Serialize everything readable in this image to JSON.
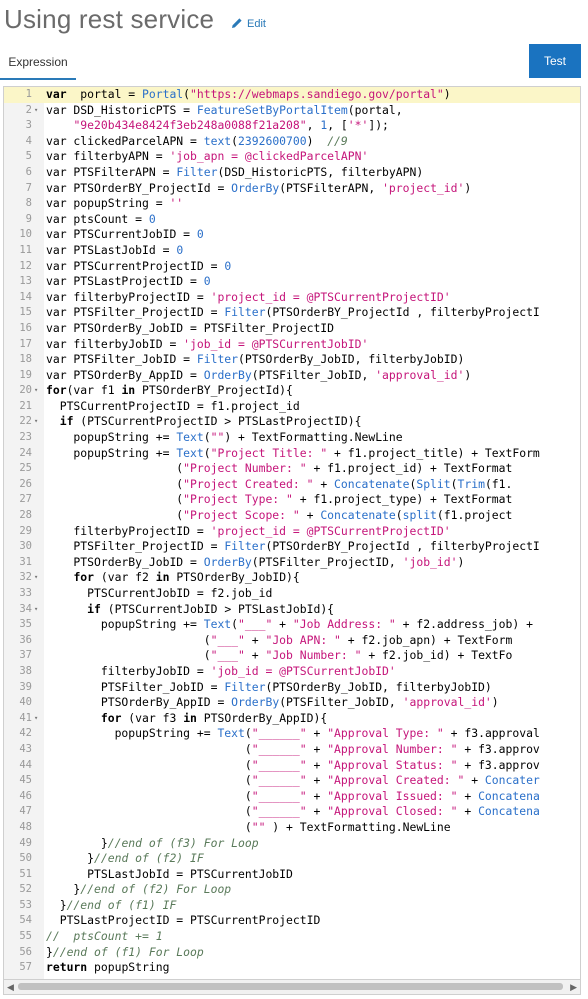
{
  "header": {
    "title": "Using rest service",
    "edit_label": "Edit"
  },
  "tabs": [
    {
      "label": "Expression"
    }
  ],
  "toolbar": {
    "test_label": "Test"
  },
  "colors": {
    "accent": "#1a73c0",
    "string": "#c5157a",
    "function": "#2a6fc9",
    "comment": "#5a7a5a"
  },
  "editor": {
    "lines": [
      {
        "n": "1",
        "fold": false,
        "t": [
          [
            "k",
            "var"
          ],
          [
            "",
            "  portal = "
          ],
          [
            "f",
            "Portal"
          ],
          [
            "",
            "("
          ],
          [
            "s",
            "\"https://webmaps.sandiego.gov/portal\""
          ],
          [
            "",
            ")"
          ]
        ]
      },
      {
        "n": "2",
        "fold": true,
        "t": [
          [
            "",
            "var DSD_HistoricPTS = "
          ],
          [
            "f",
            "FeatureSetByPortalItem"
          ],
          [
            "",
            "(portal,"
          ]
        ]
      },
      {
        "n": "3",
        "fold": false,
        "t": [
          [
            "",
            "    "
          ],
          [
            "s",
            "\"9e20b434e8424f3eb248a0088f21a208\""
          ],
          [
            "",
            ", "
          ],
          [
            "n",
            "1"
          ],
          [
            "",
            ", ["
          ],
          [
            "s",
            "'*'"
          ],
          [
            "",
            "]);"
          ]
        ]
      },
      {
        "n": "4",
        "fold": false,
        "t": [
          [
            "",
            "var clickedParcelAPN = "
          ],
          [
            "f",
            "text"
          ],
          [
            "",
            "("
          ],
          [
            "n",
            "2392600700"
          ],
          [
            "",
            ")  "
          ],
          [
            "c",
            "//9"
          ]
        ]
      },
      {
        "n": "5",
        "fold": false,
        "t": [
          [
            "",
            "var filterbyAPN = "
          ],
          [
            "s",
            "'job_apn = @clickedParcelAPN'"
          ]
        ]
      },
      {
        "n": "6",
        "fold": false,
        "t": [
          [
            "",
            "var PTSFilterAPN = "
          ],
          [
            "f",
            "Filter"
          ],
          [
            "",
            "(DSD_HistoricPTS, filterbyAPN)"
          ]
        ]
      },
      {
        "n": "7",
        "fold": false,
        "t": [
          [
            "",
            "var PTSOrderBY_ProjectId = "
          ],
          [
            "f",
            "OrderBy"
          ],
          [
            "",
            "(PTSFilterAPN, "
          ],
          [
            "s",
            "'project_id'"
          ],
          [
            "",
            ")"
          ]
        ]
      },
      {
        "n": "8",
        "fold": false,
        "t": [
          [
            "",
            "var popupString = "
          ],
          [
            "s",
            "''"
          ]
        ]
      },
      {
        "n": "9",
        "fold": false,
        "t": [
          [
            "",
            "var ptsCount = "
          ],
          [
            "n",
            "0"
          ]
        ]
      },
      {
        "n": "10",
        "fold": false,
        "t": [
          [
            "",
            "var PTSCurrentJobID = "
          ],
          [
            "n",
            "0"
          ]
        ]
      },
      {
        "n": "11",
        "fold": false,
        "t": [
          [
            "",
            "var PTSLastJobId = "
          ],
          [
            "n",
            "0"
          ]
        ]
      },
      {
        "n": "12",
        "fold": false,
        "t": [
          [
            "",
            "var PTSCurrentProjectID = "
          ],
          [
            "n",
            "0"
          ]
        ]
      },
      {
        "n": "13",
        "fold": false,
        "t": [
          [
            "",
            "var PTSLastProjectID = "
          ],
          [
            "n",
            "0"
          ]
        ]
      },
      {
        "n": "14",
        "fold": false,
        "t": [
          [
            "",
            "var filterbyProjectID = "
          ],
          [
            "s",
            "'project_id = @PTSCurrentProjectID'"
          ]
        ]
      },
      {
        "n": "15",
        "fold": false,
        "t": [
          [
            "",
            "var PTSFilter_ProjectID = "
          ],
          [
            "f",
            "Filter"
          ],
          [
            "",
            "(PTSOrderBY_ProjectId , filterbyProjectI"
          ]
        ]
      },
      {
        "n": "16",
        "fold": false,
        "t": [
          [
            "",
            "var PTSOrderBy_JobID = PTSFilter_ProjectID"
          ]
        ]
      },
      {
        "n": "17",
        "fold": false,
        "t": [
          [
            "",
            "var filterbyJobID = "
          ],
          [
            "s",
            "'job_id = @PTSCurrentJobID'"
          ]
        ]
      },
      {
        "n": "18",
        "fold": false,
        "t": [
          [
            "",
            "var PTSFilter_JobID = "
          ],
          [
            "f",
            "Filter"
          ],
          [
            "",
            "(PTSOrderBy_JobID, filterbyJobID)"
          ]
        ]
      },
      {
        "n": "19",
        "fold": false,
        "t": [
          [
            "",
            "var PTSOrderBy_AppID = "
          ],
          [
            "f",
            "OrderBy"
          ],
          [
            "",
            "(PTSFilter_JobID, "
          ],
          [
            "s",
            "'approval_id'"
          ],
          [
            "",
            ")"
          ]
        ]
      },
      {
        "n": "20",
        "fold": true,
        "t": [
          [
            "k",
            "for"
          ],
          [
            "",
            ""
          ],
          [
            "",
            "(var f1 "
          ],
          [
            "k",
            "in"
          ],
          [
            "",
            " PTSOrderBY_ProjectId){"
          ]
        ]
      },
      {
        "n": "21",
        "fold": false,
        "t": [
          [
            "",
            "  PTSCurrentProjectID = f1.project_id"
          ]
        ]
      },
      {
        "n": "22",
        "fold": true,
        "t": [
          [
            "",
            "  "
          ],
          [
            "k",
            "if"
          ],
          [
            "",
            " (PTSCurrentProjectID > PTSLastProjectID){"
          ]
        ]
      },
      {
        "n": "23",
        "fold": false,
        "t": [
          [
            "",
            "    popupString += "
          ],
          [
            "f",
            "Text"
          ],
          [
            "",
            "("
          ],
          [
            "s",
            "\"\""
          ],
          [
            "",
            ") + TextFormatting.NewLine"
          ]
        ]
      },
      {
        "n": "24",
        "fold": false,
        "t": [
          [
            "",
            "    popupString += "
          ],
          [
            "f",
            "Text"
          ],
          [
            "",
            "("
          ],
          [
            "s",
            "\"Project Title: \""
          ],
          [
            "",
            " + f1.project_title) + TextForm"
          ]
        ]
      },
      {
        "n": "25",
        "fold": false,
        "t": [
          [
            "",
            "                   ("
          ],
          [
            "s",
            "\"Project Number: \""
          ],
          [
            "",
            " + f1.project_id) + TextFormat"
          ]
        ]
      },
      {
        "n": "26",
        "fold": false,
        "t": [
          [
            "",
            "                   ("
          ],
          [
            "s",
            "\"Project Created: \""
          ],
          [
            "",
            " + "
          ],
          [
            "f",
            "Concatenate"
          ],
          [
            "",
            "("
          ],
          [
            "f",
            "Split"
          ],
          [
            "",
            "("
          ],
          [
            "f",
            "Trim"
          ],
          [
            "",
            "(f1."
          ]
        ]
      },
      {
        "n": "27",
        "fold": false,
        "t": [
          [
            "",
            "                   ("
          ],
          [
            "s",
            "\"Project Type: \""
          ],
          [
            "",
            " + f1.project_type) + TextFormat"
          ]
        ]
      },
      {
        "n": "28",
        "fold": false,
        "t": [
          [
            "",
            "                   ("
          ],
          [
            "s",
            "\"Project Scope: \""
          ],
          [
            "",
            " + "
          ],
          [
            "f",
            "Concatenate"
          ],
          [
            "",
            "("
          ],
          [
            "f",
            "split"
          ],
          [
            "",
            "(f1.project"
          ]
        ]
      },
      {
        "n": "29",
        "fold": false,
        "t": [
          [
            "",
            "    filterbyProjectID = "
          ],
          [
            "s",
            "'project_id = @PTSCurrentProjectID'"
          ]
        ]
      },
      {
        "n": "30",
        "fold": false,
        "t": [
          [
            "",
            "    PTSFilter_ProjectID = "
          ],
          [
            "f",
            "Filter"
          ],
          [
            "",
            "(PTSOrderBY_ProjectId , filterbyProjectI"
          ]
        ]
      },
      {
        "n": "31",
        "fold": false,
        "t": [
          [
            "",
            "    PTSOrderBy_JobID = "
          ],
          [
            "f",
            "OrderBy"
          ],
          [
            "",
            "(PTSFilter_ProjectID, "
          ],
          [
            "s",
            "'job_id'"
          ],
          [
            "",
            ")"
          ]
        ]
      },
      {
        "n": "32",
        "fold": true,
        "t": [
          [
            "",
            "    "
          ],
          [
            "k",
            "for"
          ],
          [
            "",
            " (var f2 "
          ],
          [
            "k",
            "in"
          ],
          [
            "",
            " PTSOrderBy_JobID){"
          ]
        ]
      },
      {
        "n": "33",
        "fold": false,
        "t": [
          [
            "",
            "      PTSCurrentJobID = f2.job_id"
          ]
        ]
      },
      {
        "n": "34",
        "fold": true,
        "t": [
          [
            "",
            "      "
          ],
          [
            "k",
            "if"
          ],
          [
            "",
            " (PTSCurrentJobID > PTSLastJobId){"
          ]
        ]
      },
      {
        "n": "35",
        "fold": false,
        "t": [
          [
            "",
            "        popupString += "
          ],
          [
            "f",
            "Text"
          ],
          [
            "",
            "("
          ],
          [
            "s",
            "\"___\""
          ],
          [
            "",
            " + "
          ],
          [
            "s",
            "\"Job Address: \""
          ],
          [
            "",
            " + f2.address_job) +"
          ]
        ]
      },
      {
        "n": "36",
        "fold": false,
        "t": [
          [
            "",
            "                       ("
          ],
          [
            "s",
            "\"___\""
          ],
          [
            "",
            " + "
          ],
          [
            "s",
            "\"Job APN: \""
          ],
          [
            "",
            " + f2.job_apn) + TextForm"
          ]
        ]
      },
      {
        "n": "37",
        "fold": false,
        "t": [
          [
            "",
            "                       ("
          ],
          [
            "s",
            "\"___\""
          ],
          [
            "",
            " + "
          ],
          [
            "s",
            "\"Job Number: \""
          ],
          [
            "",
            " + f2.job_id) + TextFo"
          ]
        ]
      },
      {
        "n": "38",
        "fold": false,
        "t": [
          [
            "",
            "        filterbyJobID = "
          ],
          [
            "s",
            "'job_id = @PTSCurrentJobID'"
          ]
        ]
      },
      {
        "n": "39",
        "fold": false,
        "t": [
          [
            "",
            "        PTSFilter_JobID = "
          ],
          [
            "f",
            "Filter"
          ],
          [
            "",
            "(PTSOrderBy_JobID, filterbyJobID)"
          ]
        ]
      },
      {
        "n": "40",
        "fold": false,
        "t": [
          [
            "",
            "        PTSOrderBy_AppID = "
          ],
          [
            "f",
            "OrderBy"
          ],
          [
            "",
            "(PTSFilter_JobID, "
          ],
          [
            "s",
            "'approval_id'"
          ],
          [
            "",
            ")"
          ]
        ]
      },
      {
        "n": "41",
        "fold": true,
        "t": [
          [
            "",
            "        "
          ],
          [
            "k",
            "for"
          ],
          [
            "",
            " (var f3 "
          ],
          [
            "k",
            "in"
          ],
          [
            "",
            " PTSOrderBy_AppID){"
          ]
        ]
      },
      {
        "n": "42",
        "fold": false,
        "t": [
          [
            "",
            "          popupString += "
          ],
          [
            "f",
            "Text"
          ],
          [
            "",
            "("
          ],
          [
            "s",
            "\"______\""
          ],
          [
            "",
            " + "
          ],
          [
            "s",
            "\"Approval Type: \""
          ],
          [
            "",
            " + f3.approval"
          ]
        ]
      },
      {
        "n": "43",
        "fold": false,
        "t": [
          [
            "",
            "                             ("
          ],
          [
            "s",
            "\"______\""
          ],
          [
            "",
            " + "
          ],
          [
            "s",
            "\"Approval Number: \""
          ],
          [
            "",
            " + f3.approv"
          ]
        ]
      },
      {
        "n": "44",
        "fold": false,
        "t": [
          [
            "",
            "                             ("
          ],
          [
            "s",
            "\"______\""
          ],
          [
            "",
            " + "
          ],
          [
            "s",
            "\"Approval Status: \""
          ],
          [
            "",
            " + f3.approv"
          ]
        ]
      },
      {
        "n": "45",
        "fold": false,
        "t": [
          [
            "",
            "                             ("
          ],
          [
            "s",
            "\"______\""
          ],
          [
            "",
            " + "
          ],
          [
            "s",
            "\"Approval Created: \""
          ],
          [
            "",
            " + "
          ],
          [
            "f",
            "Concater"
          ]
        ]
      },
      {
        "n": "46",
        "fold": false,
        "t": [
          [
            "",
            "                             ("
          ],
          [
            "s",
            "\"______\""
          ],
          [
            "",
            " + "
          ],
          [
            "s",
            "\"Approval Issued: \""
          ],
          [
            "",
            " + "
          ],
          [
            "f",
            "Concatena"
          ]
        ]
      },
      {
        "n": "47",
        "fold": false,
        "t": [
          [
            "",
            "                             ("
          ],
          [
            "s",
            "\"______\""
          ],
          [
            "",
            " + "
          ],
          [
            "s",
            "\"Approval Closed: \""
          ],
          [
            "",
            " + "
          ],
          [
            "f",
            "Concatena"
          ]
        ]
      },
      {
        "n": "48",
        "fold": false,
        "t": [
          [
            "",
            "                             ("
          ],
          [
            "s",
            "\"\""
          ],
          [
            "",
            " ) + TextFormatting.NewLine"
          ]
        ]
      },
      {
        "n": "49",
        "fold": false,
        "t": [
          [
            "",
            "        }"
          ],
          [
            "c",
            "//end of (f3) For Loop"
          ]
        ]
      },
      {
        "n": "50",
        "fold": false,
        "t": [
          [
            "",
            "      }"
          ],
          [
            "c",
            "//end of (f2) IF"
          ]
        ]
      },
      {
        "n": "51",
        "fold": false,
        "t": [
          [
            "",
            "      PTSLastJobId = PTSCurrentJobID"
          ]
        ]
      },
      {
        "n": "52",
        "fold": false,
        "t": [
          [
            "",
            "    }"
          ],
          [
            "c",
            "//end of (f2) For Loop"
          ]
        ]
      },
      {
        "n": "53",
        "fold": false,
        "t": [
          [
            "",
            "  }"
          ],
          [
            "c",
            "//end of (f1) IF"
          ]
        ]
      },
      {
        "n": "54",
        "fold": false,
        "t": [
          [
            "",
            "  PTSLastProjectID = PTSCurrentProjectID"
          ]
        ]
      },
      {
        "n": "55",
        "fold": false,
        "t": [
          [
            "c",
            "//  ptsCount += 1"
          ]
        ]
      },
      {
        "n": "56",
        "fold": false,
        "t": [
          [
            "",
            "}"
          ],
          [
            "c",
            "//end of (f1) For Loop"
          ]
        ]
      },
      {
        "n": "57",
        "fold": false,
        "t": [
          [
            "k",
            "return"
          ],
          [
            "",
            " popupString"
          ]
        ]
      }
    ]
  }
}
